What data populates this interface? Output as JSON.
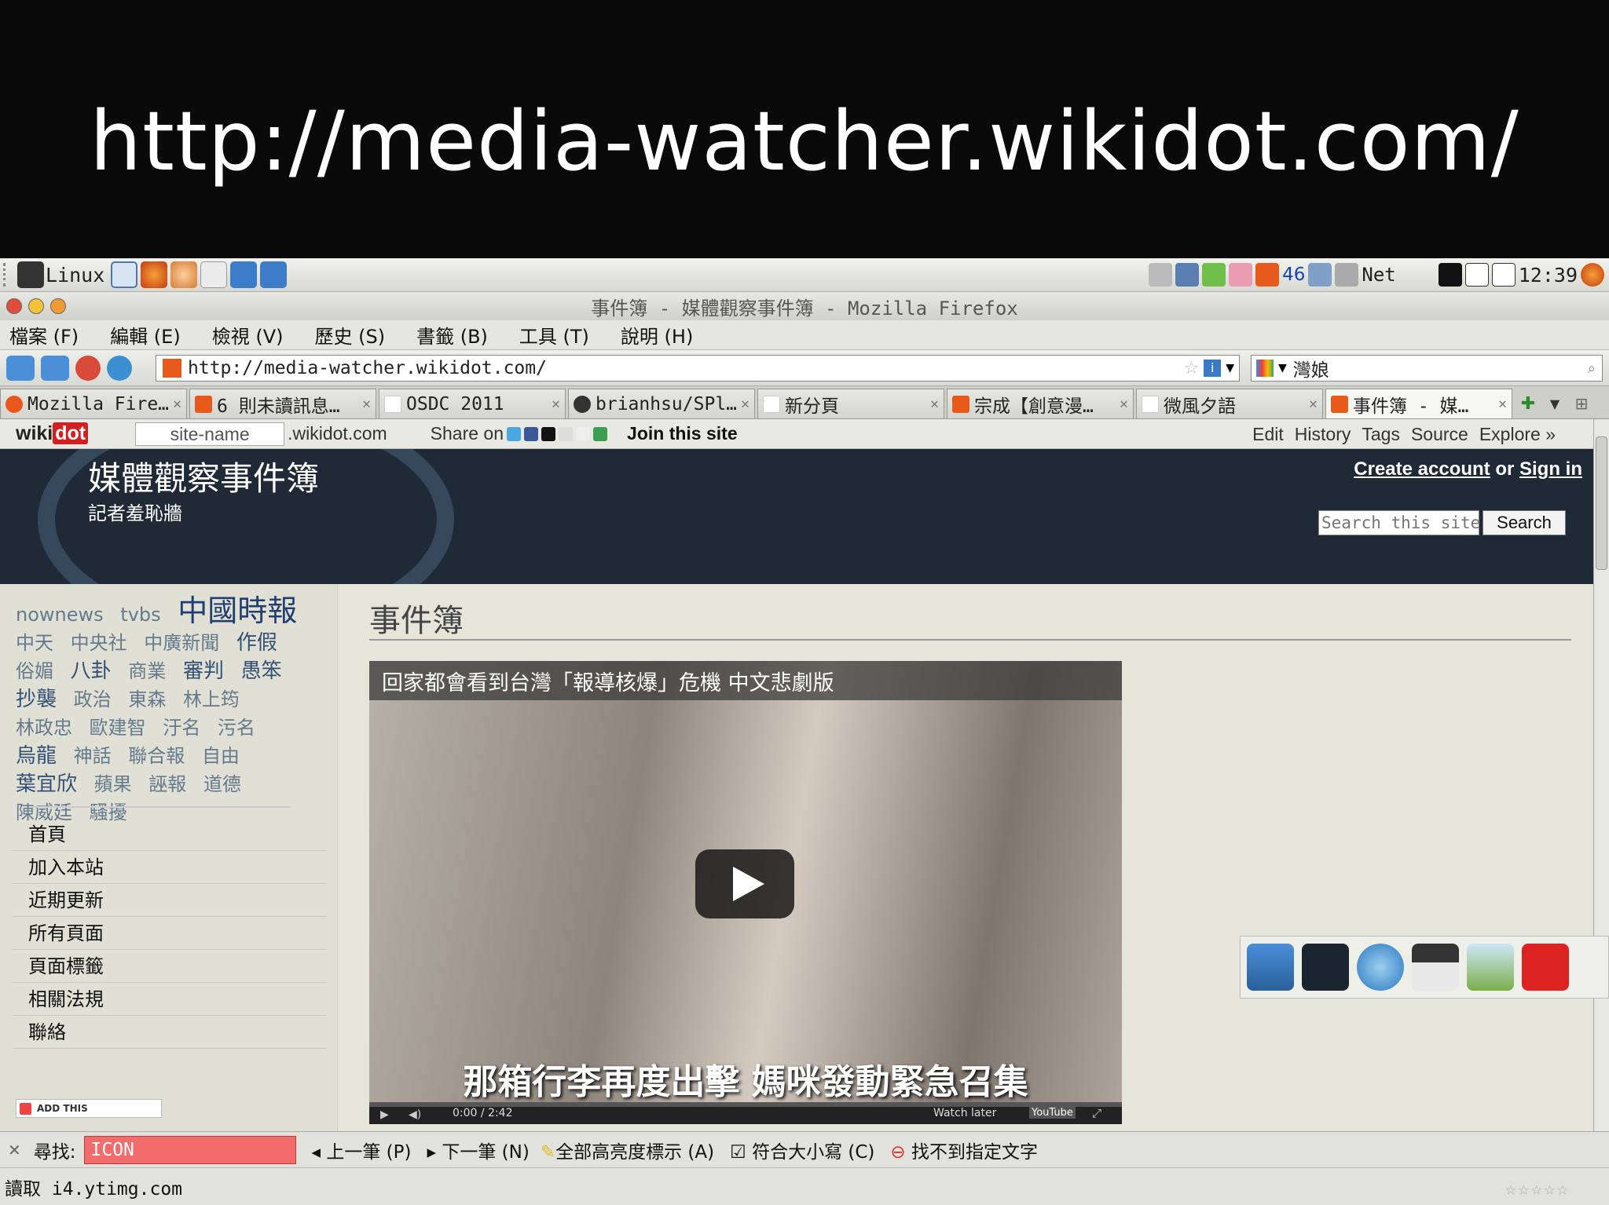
{
  "slide": {
    "title": "http://media-watcher.wikidot.com/"
  },
  "panel": {
    "start_label": "Linux",
    "tray_count": "46",
    "net_label": "Net",
    "clock": "12:39"
  },
  "window": {
    "title": "事件簿 - 媒體觀察事件簿 - Mozilla Firefox"
  },
  "menu": {
    "items": [
      "檔案 (F)",
      "編輯 (E)",
      "檢視 (V)",
      "歷史 (S)",
      "書籤 (B)",
      "工具 (T)",
      "說明 (H)"
    ]
  },
  "navbar": {
    "url": "http://media-watcher.wikidot.com/",
    "search_value": "灣娘"
  },
  "tabs": [
    {
      "label": "Mozilla Fire…",
      "color": "#e8561c"
    },
    {
      "label": "6 則未讀訊息…",
      "color": "#e85a1c"
    },
    {
      "label": "OSDC 2011",
      "color": "#ffffff"
    },
    {
      "label": "brianhsu/SPl…",
      "color": "#333333"
    },
    {
      "label": "新分頁",
      "color": "#ffffff"
    },
    {
      "label": "宗成【創意漫…",
      "color": "#e85a1c"
    },
    {
      "label": "微風夕語",
      "color": "#ffffff"
    },
    {
      "label": "事件簿 - 媒…",
      "color": "#e85a1c"
    }
  ],
  "wikibar": {
    "logo_a": "wiki",
    "logo_b": "dot",
    "site_name": "site-name",
    "domain": ".wikidot.com",
    "share": "Share on",
    "join": "Join this site",
    "nav": [
      "Edit",
      "History",
      "Tags",
      "Source",
      "Explore »"
    ]
  },
  "header": {
    "site_title": "媒體觀察事件簿",
    "subtitle": "記者羞恥牆",
    "create_account": "Create account",
    "or": "or",
    "sign_in": "Sign in",
    "search_placeholder": "Search this site",
    "search_button": "Search"
  },
  "tagcloud": [
    "nownews",
    "tvbs",
    "中國時報",
    "中天",
    "中央社",
    "中廣新聞",
    "作假",
    "俗媚",
    "八卦",
    "商業",
    "審判",
    "愚笨",
    "抄襲",
    "政治",
    "東森",
    "林上筠",
    "林政忠",
    "歐建智",
    "汙名",
    "污名",
    "烏龍",
    "神話",
    "聯合報",
    "自由",
    "葉宜欣",
    "蘋果",
    "誣報",
    "道德",
    "陳威廷",
    "騷擾"
  ],
  "sidemenu": [
    "首頁",
    "加入本站",
    "近期更新",
    "所有頁面",
    "頁面標籤",
    "相關法規",
    "聯絡"
  ],
  "addthis": "ADD THIS",
  "main": {
    "page_title": "事件簿",
    "video_title": "回家都會看到台灣「報導核爆」危機 中文悲劇版",
    "video_caption": "那箱行李再度出擊 媽咪發動緊急召集",
    "video_time": "0:00 / 2:42",
    "watch_later": "Watch later",
    "youtube": "YouTube"
  },
  "findbar": {
    "label": "尋找:",
    "value": "ICON",
    "prev": "上一筆 (P)",
    "next": "下一筆 (N)",
    "highlight": "全部高亮度標示 (A)",
    "match_case": "符合大小寫 (C)",
    "not_found": "找不到指定文字"
  },
  "status": {
    "text": "讀取 i4.ytimg.com"
  }
}
